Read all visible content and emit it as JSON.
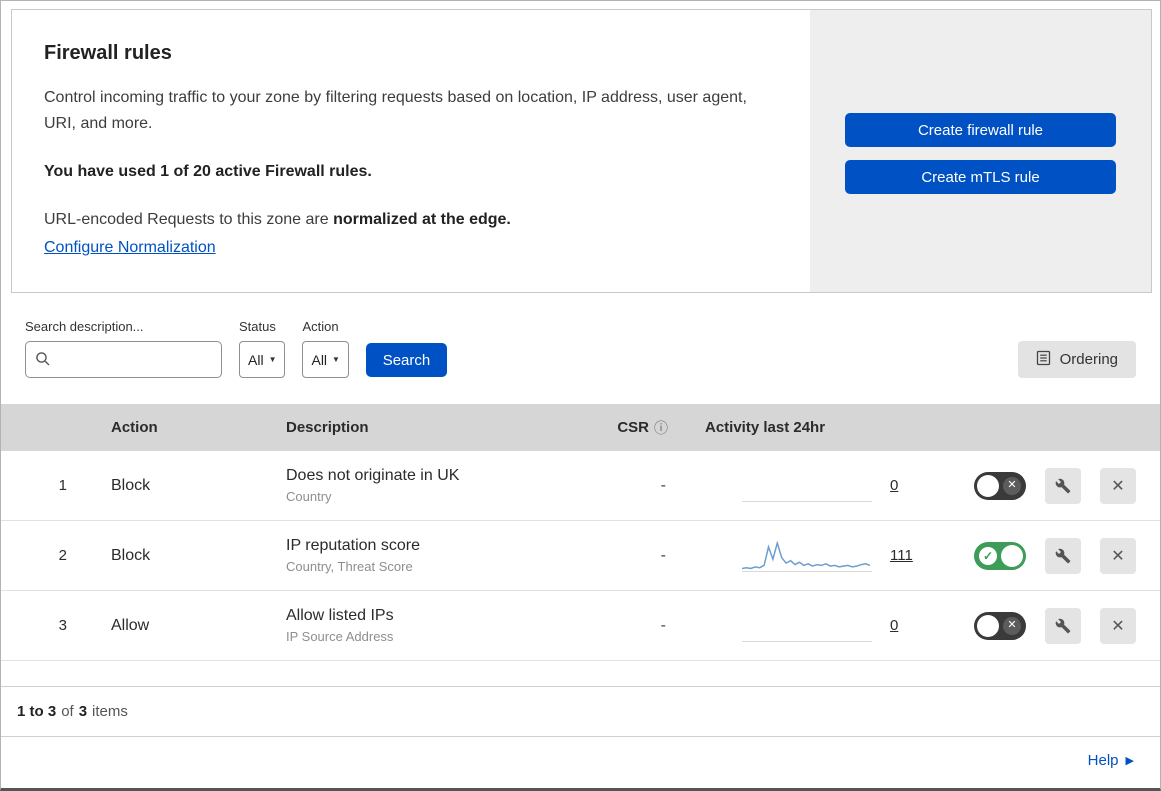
{
  "header": {
    "title": "Firewall rules",
    "description": "Control incoming traffic to your zone by filtering requests based on location, IP address, user agent, URI, and more.",
    "usage_note": "You have used 1 of 20 active Firewall rules.",
    "normalization_prefix": "URL-encoded Requests to this zone are ",
    "normalization_bold": "normalized at the edge.",
    "normalization_link": "Configure Normalization",
    "create_firewall_button": "Create firewall rule",
    "create_mtls_button": "Create mTLS rule"
  },
  "filters": {
    "search_label": "Search description...",
    "status_label": "Status",
    "status_value": "All",
    "action_label": "Action",
    "action_value": "All",
    "search_button": "Search",
    "ordering_button": "Ordering"
  },
  "table": {
    "columns": {
      "action": "Action",
      "description": "Description",
      "csr": "CSR",
      "activity": "Activity last 24hr"
    },
    "rows": [
      {
        "index": "1",
        "action": "Block",
        "description": "Does not originate in UK",
        "description_sub": "Country",
        "csr": "-",
        "activity_count": "0",
        "enabled": false,
        "sparkline": []
      },
      {
        "index": "2",
        "action": "Block",
        "description": "IP reputation score",
        "description_sub": "Country, Threat Score",
        "csr": "-",
        "activity_count": "111",
        "enabled": true,
        "sparkline": [
          2,
          3,
          2,
          4,
          3,
          6,
          30,
          14,
          35,
          16,
          9,
          12,
          7,
          10,
          6,
          8,
          5,
          7,
          6,
          8,
          5,
          6,
          4,
          5,
          6,
          4,
          5,
          7,
          8,
          6
        ]
      },
      {
        "index": "3",
        "action": "Allow",
        "description": "Allow listed IPs",
        "description_sub": "IP Source Address",
        "csr": "-",
        "activity_count": "0",
        "enabled": false,
        "sparkline": []
      }
    ]
  },
  "footer": {
    "range_bold": "1 to 3",
    "of_text": "of",
    "total_bold": "3",
    "items_text": "items"
  },
  "help_link": "Help",
  "icons": {
    "check": "✓",
    "cross": "✕",
    "dropdown": "▼",
    "info": "ⓘ",
    "help_arrow": "▶"
  },
  "colors": {
    "accent_blue": "#0051c3",
    "toggle_on_green": "#3d9c57",
    "toggle_off_gray": "#3a3a3a",
    "sparkline_blue": "#6d9ecf",
    "table_header_gray": "#d6d6d6"
  }
}
